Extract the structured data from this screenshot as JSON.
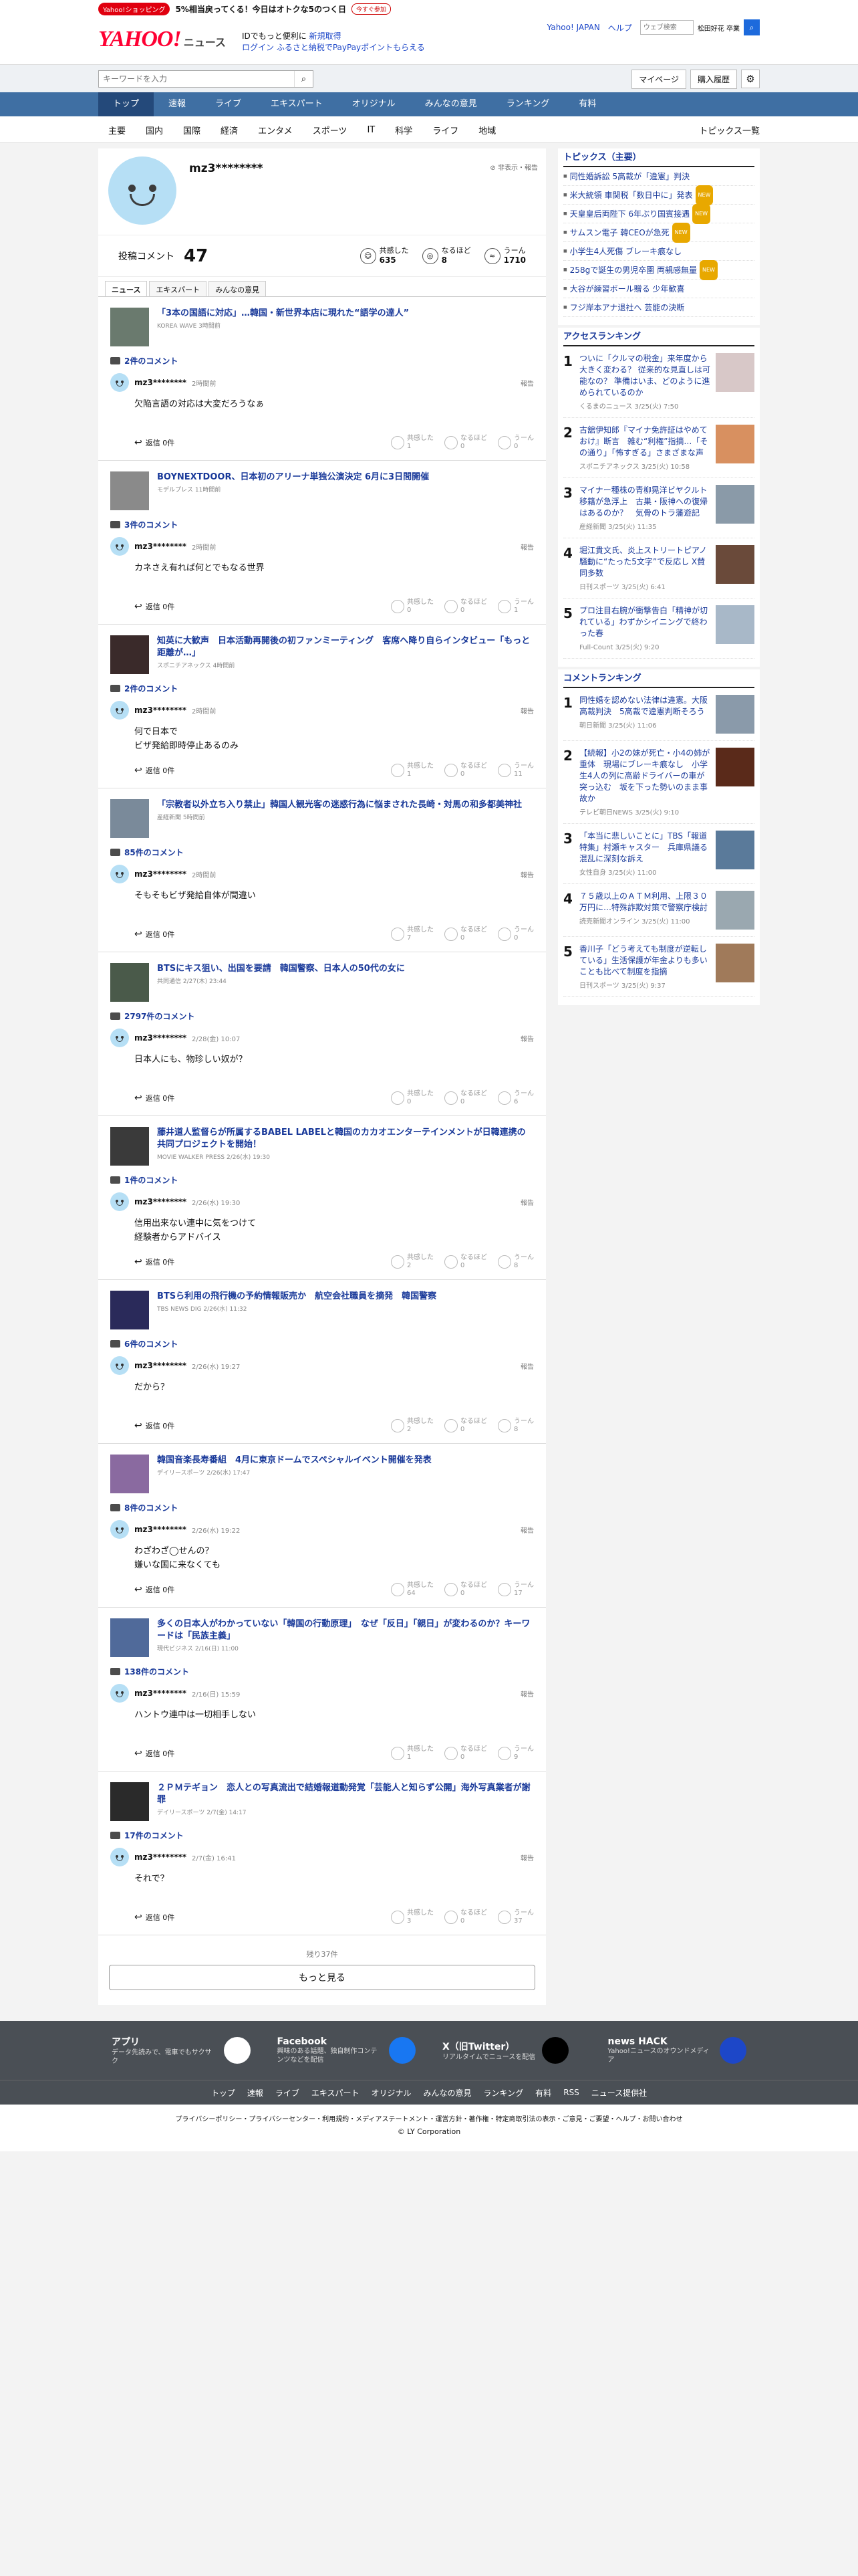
{
  "promo": {
    "badge": "Yahoo!ショッピング",
    "text": "5%相当戻ってくる！今日はオトクな5のつく日",
    "button": "今すぐ参加"
  },
  "header": {
    "logo": "YAHOO!",
    "logo_sub": "JAPAN",
    "brand": "ニュース",
    "msg_prefix": "IDでもっと便利に",
    "msg_link1": "新規取得",
    "msg_link2": "ログイン",
    "msg_rest": "ふるさと納税でPayPayポイントもらえる",
    "links": [
      "Yahoo! JAPAN",
      "ヘルプ"
    ],
    "web_search_placeholder": "ウェブ検索",
    "location": "松田好花 卒業"
  },
  "search": {
    "placeholder": "キーワードを入力",
    "mypage": "マイページ",
    "history": "購入履歴"
  },
  "nav": [
    "トップ",
    "速報",
    "ライブ",
    "エキスパート",
    "オリジナル",
    "みんなの意見",
    "ランキング",
    "有料"
  ],
  "subnav": [
    "主要",
    "国内",
    "国際",
    "経済",
    "エンタメ",
    "スポーツ",
    "IT",
    "科学",
    "ライフ",
    "地域"
  ],
  "subnav_right": "トピックス一覧",
  "profile": {
    "name": "mz3********",
    "hide": "非表示・報告",
    "posts_label": "投稿コメント",
    "posts_count": "47",
    "reactions": [
      {
        "label": "共感した",
        "value": "635"
      },
      {
        "label": "なるほど",
        "value": "8"
      },
      {
        "label": "うーん",
        "value": "1710"
      }
    ],
    "tabs": [
      "ニュース",
      "エキスパート",
      "みんなの意見"
    ]
  },
  "comments": [
    {
      "title": "「3本の国語に対応」…韓国・新世界本店に現れた“語学の達人”",
      "source": "KOREA WAVE 3時間前",
      "count": "2件のコメント",
      "time": "2時間前",
      "text": [
        "欠陥言語の対応は大変だろうなぁ"
      ],
      "reply": "返信 0件",
      "v": [
        "1",
        "0",
        "0"
      ]
    },
    {
      "title": "BOYNEXTDOOR、日本初のアリーナ単独公演決定 6月に3日間開催",
      "source": "モデルプレス 11時間前",
      "count": "3件のコメント",
      "time": "2時間前",
      "text": [
        "カネさえ有れば何とでもなる世界"
      ],
      "reply": "返信 0件",
      "v": [
        "0",
        "0",
        "1"
      ]
    },
    {
      "title": "知英に大歓声　日本活動再開後の初ファンミーティング　客席へ降り自らインタビュー「もっと距離が…」",
      "source": "スポニチアネックス 4時間前",
      "count": "2件のコメント",
      "time": "2時間前",
      "text": [
        "何で日本で",
        "ビザ発給即時停止あるのみ"
      ],
      "reply": "返信 0件",
      "v": [
        "1",
        "0",
        "11"
      ]
    },
    {
      "title": "「宗教者以外立ち入り禁止」韓国人観光客の迷惑行為に悩まされた長崎・対馬の和多都美神社",
      "source": "産経新聞 5時間前",
      "count": "85件のコメント",
      "time": "2時間前",
      "text": [
        "そもそもビザ発給自体が間違い"
      ],
      "reply": "返信 0件",
      "v": [
        "7",
        "0",
        "0"
      ]
    },
    {
      "title": "BTSにキス狙い、出国を要請　韓国警察、日本人の50代の女に",
      "source": "共同通信 2/27(木) 23:44",
      "count": "2797件のコメント",
      "time": "2/28(金) 10:07",
      "text": [
        "日本人にも、物珍しい奴が？"
      ],
      "reply": "返信 0件",
      "v": [
        "0",
        "0",
        "6"
      ]
    },
    {
      "title": "藤井道人監督らが所属するBABEL LABELと韓国のカカオエンターテインメントが日韓連携の共同プロジェクトを開始！",
      "source": "MOVIE WALKER PRESS 2/26(水) 19:30",
      "count": "1件のコメント",
      "time": "2/26(水) 19:30",
      "text": [
        "信用出来ない連中に気をつけて",
        "経験者からアドバイス"
      ],
      "reply": "返信 0件",
      "v": [
        "2",
        "0",
        "8"
      ]
    },
    {
      "title": "BTSら利用の飛行機の予約情報販売か　航空会社職員を摘発　韓国警察",
      "source": "TBS NEWS DIG 2/26(水) 11:32",
      "count": "6件のコメント",
      "time": "2/26(水) 19:27",
      "text": [
        "だから？"
      ],
      "reply": "返信 0件",
      "v": [
        "2",
        "0",
        "8"
      ]
    },
    {
      "title": "韓国音楽長寿番組　4月に東京ドームでスペシャルイベント開催を発表",
      "source": "デイリースポーツ 2/26(水) 17:47",
      "count": "8件のコメント",
      "time": "2/26(水) 19:22",
      "text": [
        "わざわざ◯せんの？",
        "嫌いな国に来なくても"
      ],
      "reply": "返信 0件",
      "v": [
        "64",
        "0",
        "17"
      ]
    },
    {
      "title": "多くの日本人がわかっていない「韓国の行動原理」　なぜ「反日」「親日」が変わるのか？キーワードは「民族主義」",
      "source": "現代ビジネス 2/16(日) 11:00",
      "count": "138件のコメント",
      "time": "2/16(日) 15:59",
      "text": [
        "ハントウ連中は一切相手しない"
      ],
      "reply": "返信 0件",
      "v": [
        "1",
        "0",
        "9"
      ]
    },
    {
      "title": "２ＰＭテギョン　恋人との写真流出で結婚報道動発覚「芸能人と知らず公開」海外写真業者が謝罪",
      "source": "デイリースポーツ 2/7(金) 14:17",
      "count": "17件のコメント",
      "time": "2/7(金) 16:41",
      "text": [
        "それで？"
      ],
      "reply": "返信 0件",
      "v": [
        "3",
        "0",
        "37"
      ]
    }
  ],
  "vote_labels": [
    "共感した",
    "なるほど",
    "うーん"
  ],
  "report": "報告",
  "more": {
    "remain": "残り37件",
    "button": "もっと見る"
  },
  "topics": {
    "title": "トピックス（主要）",
    "items": [
      {
        "text": "同性婚訴訟 5高裁が「違憲」判決",
        "tag": ""
      },
      {
        "text": "米大統領 車関税「数日中に」発表",
        "tag": "NEW"
      },
      {
        "text": "天皇皇后両陛下 6年ぶり国賓接遇",
        "tag": "NEW"
      },
      {
        "text": "サムスン電子 韓CEOが急死",
        "tag": "NEW"
      },
      {
        "text": "小学生4人死傷 ブレーキ痕なし",
        "tag": ""
      },
      {
        "text": "258gで誕生の男児卒園 両親感無量",
        "tag": "NEW"
      },
      {
        "text": "大谷が練習ボール贈る 少年歓喜",
        "tag": ""
      },
      {
        "text": "フジ岸本アナ退社へ 芸能の決断",
        "tag": ""
      }
    ]
  },
  "access_ranking": {
    "title": "アクセスランキング",
    "items": [
      {
        "no": "1",
        "title": "ついに「クルマの税金」来年度から大きく変わる？ 従来的な見直しは可能なの？ 準備はいま、どのように進められているのか",
        "meta": "くるまのニュース 3/25(火) 7:50"
      },
      {
        "no": "2",
        "title": "古舘伊知郎『マイナ免許証はやめておけ』断言　雑む“利権”指摘…「その通り」「怖すぎる」さまざまな声",
        "meta": "スポニチアネックス 3/25(火) 10:58"
      },
      {
        "no": "3",
        "title": "マイナー種株の青柳晃洋ビヤクルト移籍が急浮上　古巣・阪神への復帰はあるのか？　気骨のトラ藩遊記",
        "meta": "産経新聞 3/25(火) 11:35"
      },
      {
        "no": "4",
        "title": "堀江貴文氏、炎上ストリートピアノ騒動に“たった5文字”で反応し X賛同多数",
        "meta": "日刊スポーツ 3/25(火) 6:41"
      },
      {
        "no": "5",
        "title": "プロ注目右腕が衝撃告白「精神が切れている」わずかシイニングで終わった春",
        "meta": "Full-Count 3/25(火) 9:20"
      }
    ]
  },
  "comment_ranking": {
    "title": "コメントランキング",
    "items": [
      {
        "no": "1",
        "title": "同性婚を認めない法律は違憲。大阪高裁判決　5高裁で違憲判断そろう",
        "meta": "朝日新聞 3/25(火) 11:06"
      },
      {
        "no": "2",
        "title": "【続報】小2の妹が死亡・小4の姉が重体　現場にブレーキ痕なし　小学生4人の列に高齢ドライバーの車が突っ込む　坂を下った勢いのまま事故か",
        "meta": "テレビ朝日NEWS 3/25(火) 9:10"
      },
      {
        "no": "3",
        "title": "「本当に悲しいことに」TBS「報道特集」村瀬キャスター　兵庫県議る混乱に深刻な訴え",
        "meta": "女性自身 3/25(火) 11:00"
      },
      {
        "no": "4",
        "title": "７５歳以上のＡＴＭ利用、上限３０万円に…特殊詐欺対策で警察庁検討",
        "meta": "読売新聞オンライン 3/25(火) 11:00"
      },
      {
        "no": "5",
        "title": "香川子「どう考えても制度が逆転している」生活保護が年金よりも多いことも比べて制度を指摘",
        "meta": "日刊スポーツ 3/25(火) 9:37"
      }
    ]
  },
  "footer": {
    "apps": [
      {
        "name": "アプリ",
        "desc": "データ先読みで、電車でもサクサク"
      },
      {
        "name": "Facebook",
        "desc": "興味のある話題、独自制作コンテンツなどを配信"
      },
      {
        "name": "X（旧Twitter）",
        "desc": "リアルタイムでニュースを配信"
      },
      {
        "name": "news HACK",
        "desc": "Yahoo!ニュースのオウンドメディア"
      }
    ],
    "nav": [
      "トップ",
      "速報",
      "ライブ",
      "エキスパート",
      "オリジナル",
      "みんなの意見",
      "ランキング",
      "有料",
      "RSS",
      "ニュース提供社"
    ],
    "legal": "プライバシーポリシー・プライバシーセンター・利用規約・メディアステートメント・運営方針・著作権・特定商取引法の表示・ご意見・ご要望・ヘルプ・お問い合わせ",
    "copyright": "© LY Corporation"
  }
}
